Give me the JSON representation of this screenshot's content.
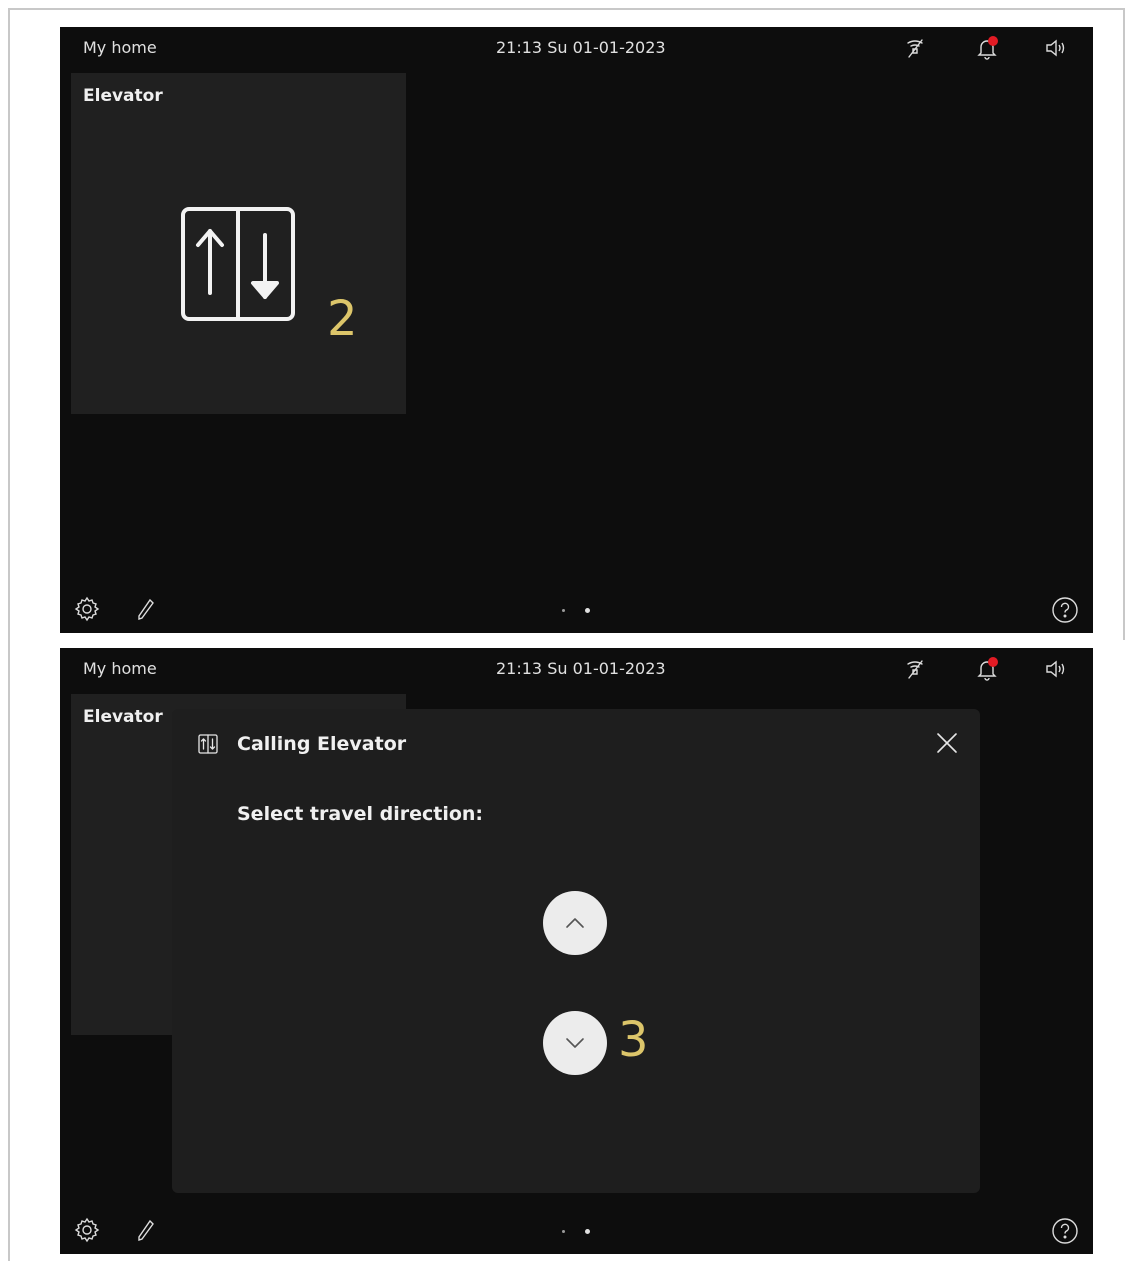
{
  "screens": [
    {
      "status_bar": {
        "title": "My home",
        "datetime": "21:13  Su 01-01-2023"
      },
      "tile": {
        "title": "Elevator",
        "callout": "2"
      }
    },
    {
      "status_bar": {
        "title": "My home",
        "datetime": "21:13  Su 01-01-2023"
      },
      "tile": {
        "title": "Elevator"
      },
      "dialog": {
        "title": "Calling Elevator",
        "prompt": "Select travel direction:",
        "callout": "3"
      }
    }
  ],
  "icons": {
    "mute": "microphone-mute-icon",
    "bell": "notification-bell-icon",
    "speaker": "speaker-volume-icon",
    "gear": "gear-icon",
    "pen": "pen-edit-icon",
    "help": "help-icon",
    "elevator": "elevator-icon",
    "close": "close-icon",
    "up": "chevron-up-icon",
    "down": "chevron-down-icon"
  },
  "colors": {
    "screen_bg": "#0d0d0d",
    "tile_bg": "#202020",
    "dialog_bg": "#1e1e1e",
    "callout": "#dcc56a",
    "notification_dot": "#e21b24"
  }
}
